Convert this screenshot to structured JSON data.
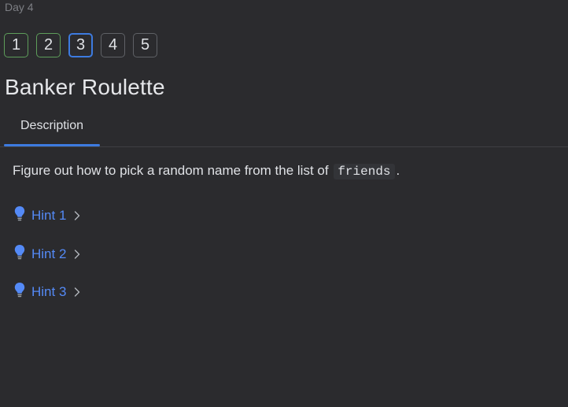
{
  "header": {
    "day_label": "Day 4",
    "title": "Banker Roulette"
  },
  "steps": [
    {
      "label": "1",
      "state": "done"
    },
    {
      "label": "2",
      "state": "done"
    },
    {
      "label": "3",
      "state": "current"
    },
    {
      "label": "4",
      "state": "pending"
    },
    {
      "label": "5",
      "state": "pending"
    }
  ],
  "tabs": {
    "description_label": "Description"
  },
  "description": {
    "text_before": "Figure out how to pick a random name from the list of",
    "code": "friends",
    "text_after": "."
  },
  "hints": [
    {
      "label": "Hint 1",
      "icon": "lightbulb-icon"
    },
    {
      "label": "Hint 2",
      "icon": "lightbulb-icon"
    },
    {
      "label": "Hint 3",
      "icon": "lightbulb-icon"
    }
  ],
  "colors": {
    "background": "#2b2b2e",
    "accent": "#3d7be0",
    "done": "#5e9d5a",
    "link": "#548af7"
  }
}
